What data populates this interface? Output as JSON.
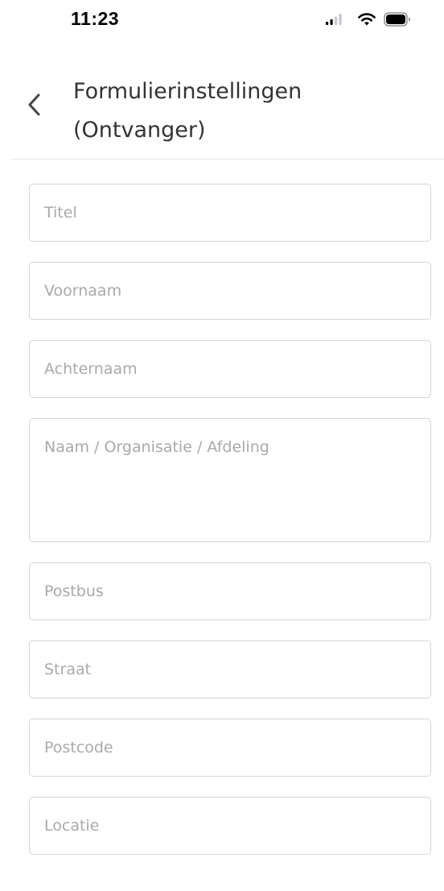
{
  "status_bar": {
    "time": "11:23",
    "icons": [
      "signal-icon",
      "wifi-icon",
      "battery-icon"
    ]
  },
  "header": {
    "back_icon": "chevron-left-icon",
    "title_line1": "Formulierinstellingen",
    "title_line2": "(Ontvanger)"
  },
  "form": {
    "fields": [
      {
        "label": "Titel"
      },
      {
        "label": "Voornaam"
      },
      {
        "label": "Achternaam"
      },
      {
        "label": "Naam / Organisatie / Afdeling"
      },
      {
        "label": "Postbus"
      },
      {
        "label": "Straat"
      },
      {
        "label": "Postcode"
      },
      {
        "label": "Locatie"
      },
      {
        "label": ""
      }
    ]
  },
  "colors": {
    "background": "#ffffff",
    "border": "#d4d4d4",
    "placeholder": "#a9a9a9",
    "title": "#333333"
  }
}
